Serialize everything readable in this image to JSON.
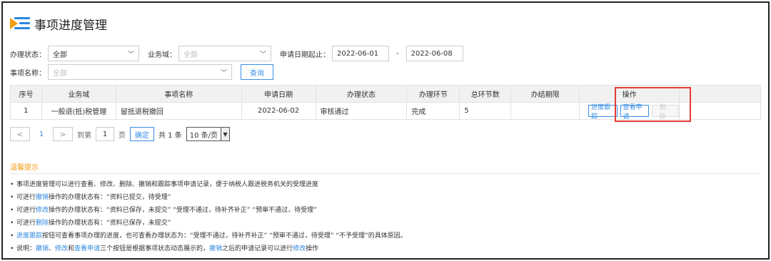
{
  "header": {
    "title": "事项进度管理",
    "colors": {
      "accent": "#2e86de",
      "logo_orange": "#f39c12",
      "highlight": "#e53935"
    }
  },
  "filters": {
    "status_label": "办理状态：",
    "status_value": "全部",
    "domain_label": "业务域：",
    "domain_placeholder": "全部",
    "date_label": "申请日期起止：",
    "date_from": "2022-06-01",
    "date_sep": "-",
    "date_to": "2022-06-08",
    "item_label": "事项名称：",
    "item_placeholder": "全部",
    "query_label": "查询"
  },
  "table": {
    "columns": [
      "序号",
      "业务域",
      "事项名称",
      "申请日期",
      "办理状态",
      "办理环节",
      "总环节数",
      "办结期限",
      "操作"
    ],
    "rows": [
      {
        "no": "1",
        "domain": "一般退(抵)税管理",
        "item": "留抵退税撤回",
        "date": "2022-06-02",
        "status": "审核通过",
        "stage": "完成",
        "total": "5",
        "deadline": "",
        "actions": {
          "track": "进度跟踪",
          "view": "查看申请",
          "delete": "删除"
        }
      }
    ]
  },
  "pager": {
    "prev": "<",
    "page": "1",
    "next": ">",
    "goto_label": "到第",
    "goto_value": "1",
    "page_unit": "页",
    "confirm": "确定",
    "total": "共 1 条",
    "page_size": "10 条/页"
  },
  "tips": {
    "title": "温馨提示",
    "lines": [
      {
        "parts": [
          "事项进度管理可以进行查看、修改、删除、撤销和跟踪事项申请记录，便于纳税人跟进税务机关的受理进度"
        ]
      },
      {
        "parts": [
          "可进行",
          "撤销",
          "操作的办理状态有：“资料已提交，待受理”"
        ]
      },
      {
        "parts": [
          "可进行",
          "修改",
          "操作的办理状态有：“资料已保存，未提交” “受理不通过，待补齐补正” “预审不通过，待受理”"
        ]
      },
      {
        "parts": [
          "可进行",
          "删除",
          "操作的办理状态有：“资料已保存，未提交”"
        ]
      },
      {
        "parts": [
          "进度跟踪",
          "按钮可查看事项办理的进度，也可查看办理状态为：“受理不通过，待补齐补正” “预审不通过，待受理” “不予受理”的具体原因。"
        ]
      },
      {
        "parts": [
          "说明：",
          "撤销",
          "、",
          "修改",
          "和",
          "查看申请",
          "三个按钮是根据事项状态动态展示的，",
          "撤销",
          "之后的申请记录可以进行",
          "修改",
          "操作"
        ]
      }
    ]
  }
}
